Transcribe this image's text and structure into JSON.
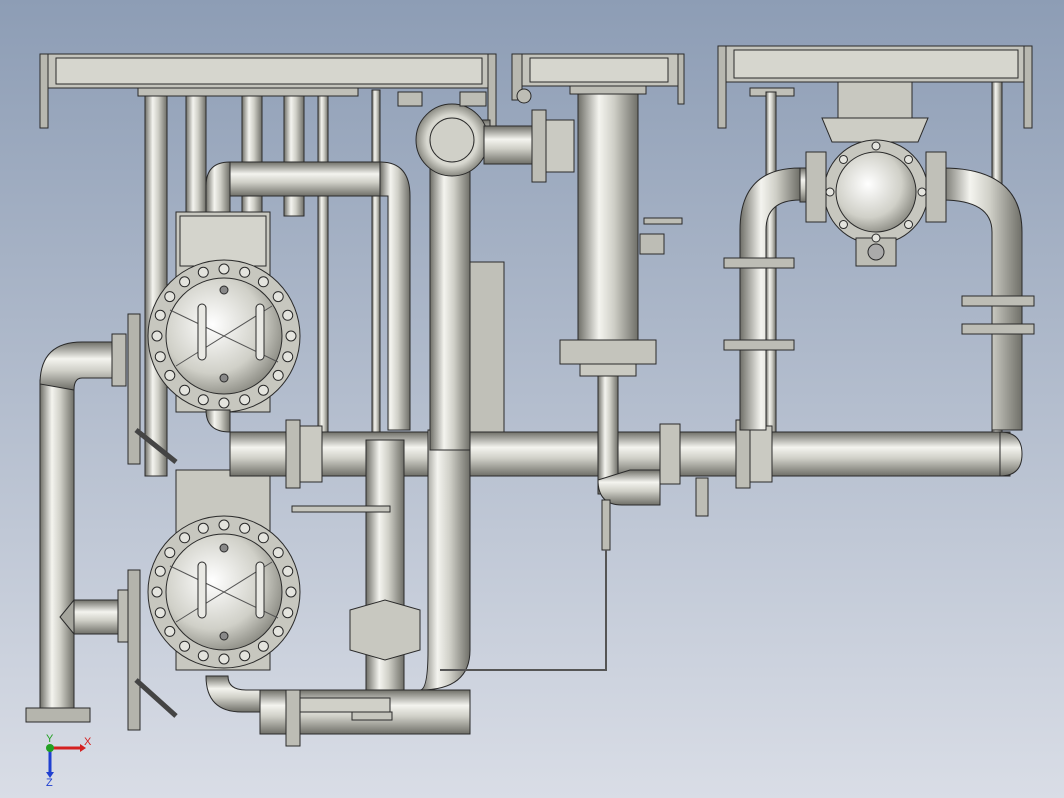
{
  "view": {
    "background_top": "#8d9db5",
    "background_bottom": "#d9dde6",
    "metal_dark": "#7c7c74",
    "metal_mid": "#c9c9c1",
    "metal_light": "#f1f1ec",
    "outline": "#2a2a2a"
  },
  "triad": {
    "x_label": "X",
    "y_label": "Y",
    "z_label": "Z",
    "x_color": "#d42020",
    "y_color": "#22a022",
    "z_color": "#2040d0"
  }
}
